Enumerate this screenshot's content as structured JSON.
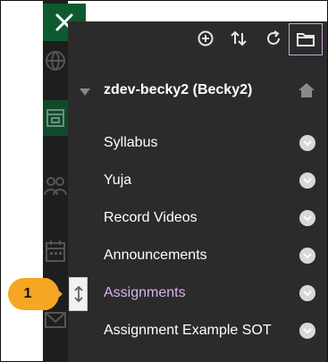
{
  "course": {
    "title": "zdev-becky2 (Becky2)"
  },
  "menu": {
    "items": [
      {
        "label": "Syllabus"
      },
      {
        "label": "Yuja"
      },
      {
        "label": "Record Videos"
      },
      {
        "label": "Announcements"
      },
      {
        "label": "Assignments",
        "active": true
      },
      {
        "label": "Assignment Example SOT"
      }
    ]
  },
  "callout": {
    "number": "1"
  },
  "colors": {
    "panel_bg": "#2b2b2b",
    "close_bg": "#0d5a31",
    "active_item": "#d9b3e6",
    "folder_border": "#c9a6d9",
    "callout": "#f5a623"
  },
  "icons": {
    "close": "close-icon",
    "add": "add-circle-icon",
    "sort": "sort-arrows-icon",
    "refresh": "refresh-icon",
    "folder": "folder-icon",
    "home": "home-icon",
    "caret": "caret-down-icon",
    "chevron": "chevron-down-circle-icon",
    "drag": "drag-handle-icon"
  }
}
